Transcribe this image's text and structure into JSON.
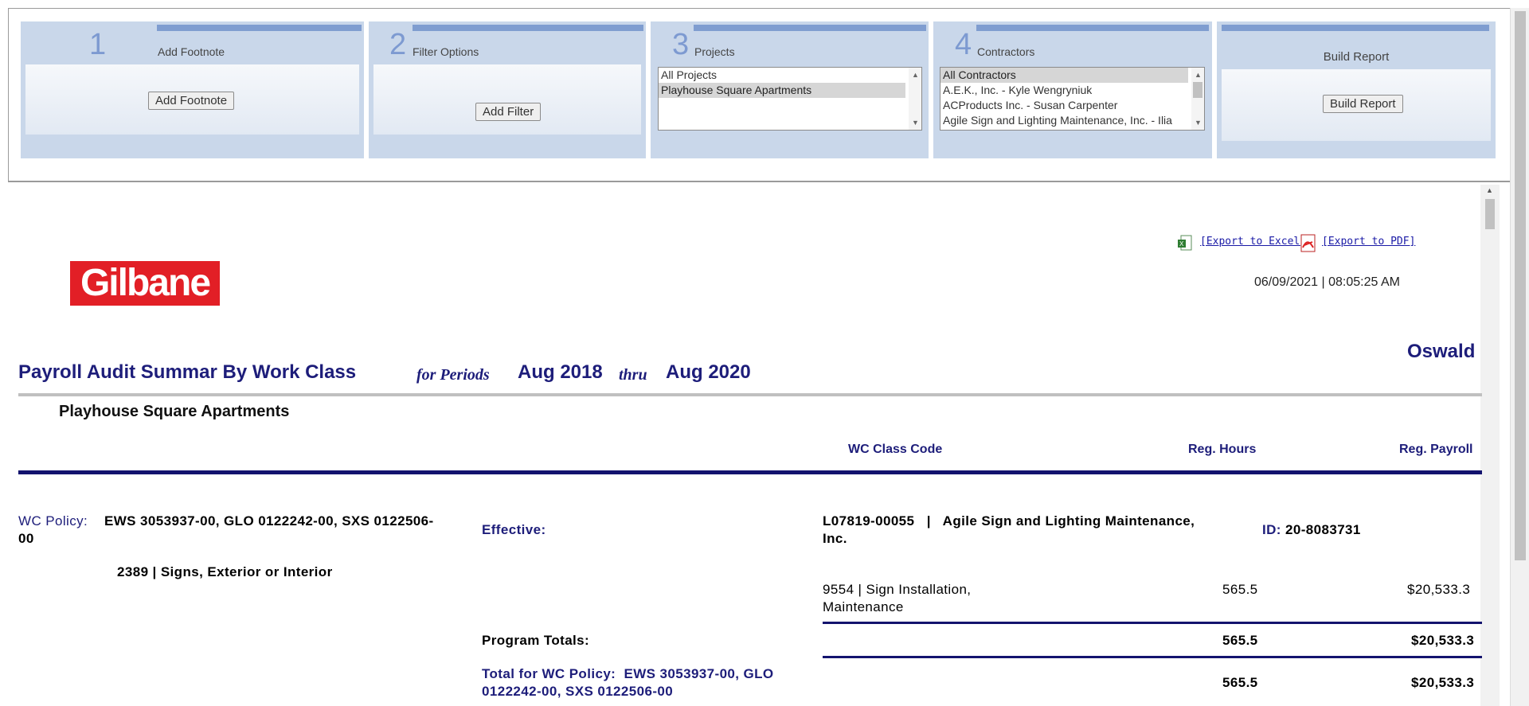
{
  "wizard": {
    "step1": {
      "num": "1",
      "title": "Add Footnote",
      "button": "Add Footnote"
    },
    "step2": {
      "num": "2",
      "title": "Filter Options",
      "button": "Add Filter"
    },
    "step3": {
      "num": "3",
      "title": "Projects",
      "options": [
        "All Projects",
        "Playhouse Square Apartments"
      ],
      "selected": "Playhouse Square Apartments"
    },
    "step4": {
      "num": "4",
      "title": "Contractors",
      "options": [
        "All Contractors",
        "A.E.K., Inc. - Kyle Wengryniuk",
        "ACProducts Inc. - Susan Carpenter",
        "Agile Sign and Lighting Maintenance, Inc. - Ilia"
      ],
      "selected": "All Contractors"
    },
    "build": {
      "title": "Build Report",
      "button": "Build Report"
    }
  },
  "report": {
    "logo_text": "Gilbane",
    "export_excel": "[Export to Excel]",
    "export_pdf": "[Export to PDF]",
    "datetime": "06/09/2021 | 08:05:25 AM",
    "owner": "Oswald",
    "title": "Payroll Audit Summar By Work Class",
    "for_periods": "for Periods",
    "period_start": "Aug 2018",
    "thru": "thru",
    "period_end": "Aug 2020",
    "project": "Playhouse Square Apartments",
    "columns": {
      "wc_class_code": "WC Class Code",
      "reg_hours": "Reg. Hours",
      "reg_payroll": "Reg. Payroll"
    },
    "policy": {
      "label": "WC Policy:",
      "value": "EWS 3053937-00, GLO 0122242-00, SXS 0122506-",
      "value_wrap": "00",
      "effective_label": "Effective:",
      "contractor": "L07819-00055   |   Agile Sign and Lighting Maintenance,",
      "contractor_wrap": "Inc.",
      "id_label": "ID:",
      "id_value": "20-8083731",
      "work_class": "2389 | Signs, Exterior or Interior",
      "row": {
        "code": "9554 | Sign Installation,",
        "code_wrap": "Maintenance",
        "hours": "565.5",
        "payroll": "$20,533.3"
      },
      "program_totals_label": "Program Totals:",
      "program_hours": "565.5",
      "program_payroll": "$20,533.3",
      "policy_total_label": "Total for WC Policy:  EWS 3053937-00, GLO",
      "policy_total_wrap": "0122242-00, SXS 0122506-00",
      "policy_hours": "565.5",
      "policy_payroll": "$20,533.3"
    }
  },
  "colors": {
    "accent": "#7f9dd0",
    "panel": "#c9d7ea",
    "navy": "#1d1d7a",
    "logo_red": "#e21f26"
  }
}
